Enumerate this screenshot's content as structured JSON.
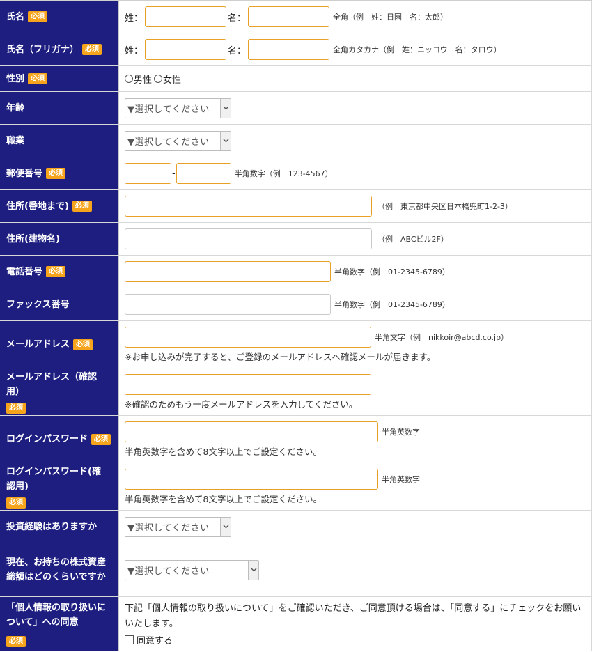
{
  "required_badge": "必須",
  "rows": {
    "name": {
      "label": "氏名",
      "sei_label": "姓：",
      "mei_label": "名：",
      "sei_value": "",
      "mei_value": "",
      "hint": "全角（例　姓：日園　名：太郎）"
    },
    "kana": {
      "label": "氏名（フリガナ）",
      "sei_label": "姓：",
      "mei_label": "名：",
      "sei_value": "",
      "mei_value": "",
      "hint": "全角カタカナ（例　姓：ニッコウ　名：タロウ）"
    },
    "gender": {
      "label": "性別",
      "opt_male": "男性",
      "opt_female": "女性"
    },
    "age": {
      "label": "年齢",
      "select": "▼選択してください"
    },
    "job": {
      "label": "職業",
      "select": "▼選択してください"
    },
    "zip": {
      "label": "郵便番号",
      "dash": "-",
      "hint": "半角数字（例　123-4567）"
    },
    "address1": {
      "label": "住所(番地まで)",
      "hint": "（例　東京都中央区日本橋兜町1-2-3）"
    },
    "address2": {
      "label": "住所(建物名)",
      "hint": "（例　ABCビル2F）"
    },
    "phone": {
      "label": "電話番号",
      "hint": "半角数字（例　01-2345-6789）"
    },
    "fax": {
      "label": "ファックス番号",
      "hint": "半角数字（例　01-2345-6789）"
    },
    "email": {
      "label": "メールアドレス",
      "hint": "半角文字（例　nikkoir@abcd.co.jp）",
      "note": "※お申し込みが完了すると、ご登録のメールアドレスへ確認メールが届きます。"
    },
    "email_confirm": {
      "label": "メールアドレス（確認用）",
      "note": "※確認のためもう一度メールアドレスを入力してください。"
    },
    "password": {
      "label": "ログインパスワード",
      "hint": "半角英数字",
      "note": "半角英数字を含めて8文字以上でご設定ください。"
    },
    "password_confirm": {
      "label": "ログインパスワード(確認用)",
      "hint": "半角英数字",
      "note": "半角英数字を含めて8文字以上でご設定ください。"
    },
    "experience": {
      "label": "投資経験はありますか",
      "select": "▼選択してください"
    },
    "assets": {
      "label": "現在、お持ちの株式資産総額はどのくらいですか",
      "select": "▼選択してください"
    },
    "privacy": {
      "label": "「個人情報の取り扱いについて」への同意",
      "text": "下記「個人情報の取り扱いについて」をご確認いただき、ご同意頂ける場合は、「同意する」にチェックをお願いいたします。",
      "agree": "同意する"
    }
  },
  "colors": {
    "label_bg": "#1d1e80",
    "badge_bg": "#f5a41b",
    "input_border": "#e9a028"
  }
}
